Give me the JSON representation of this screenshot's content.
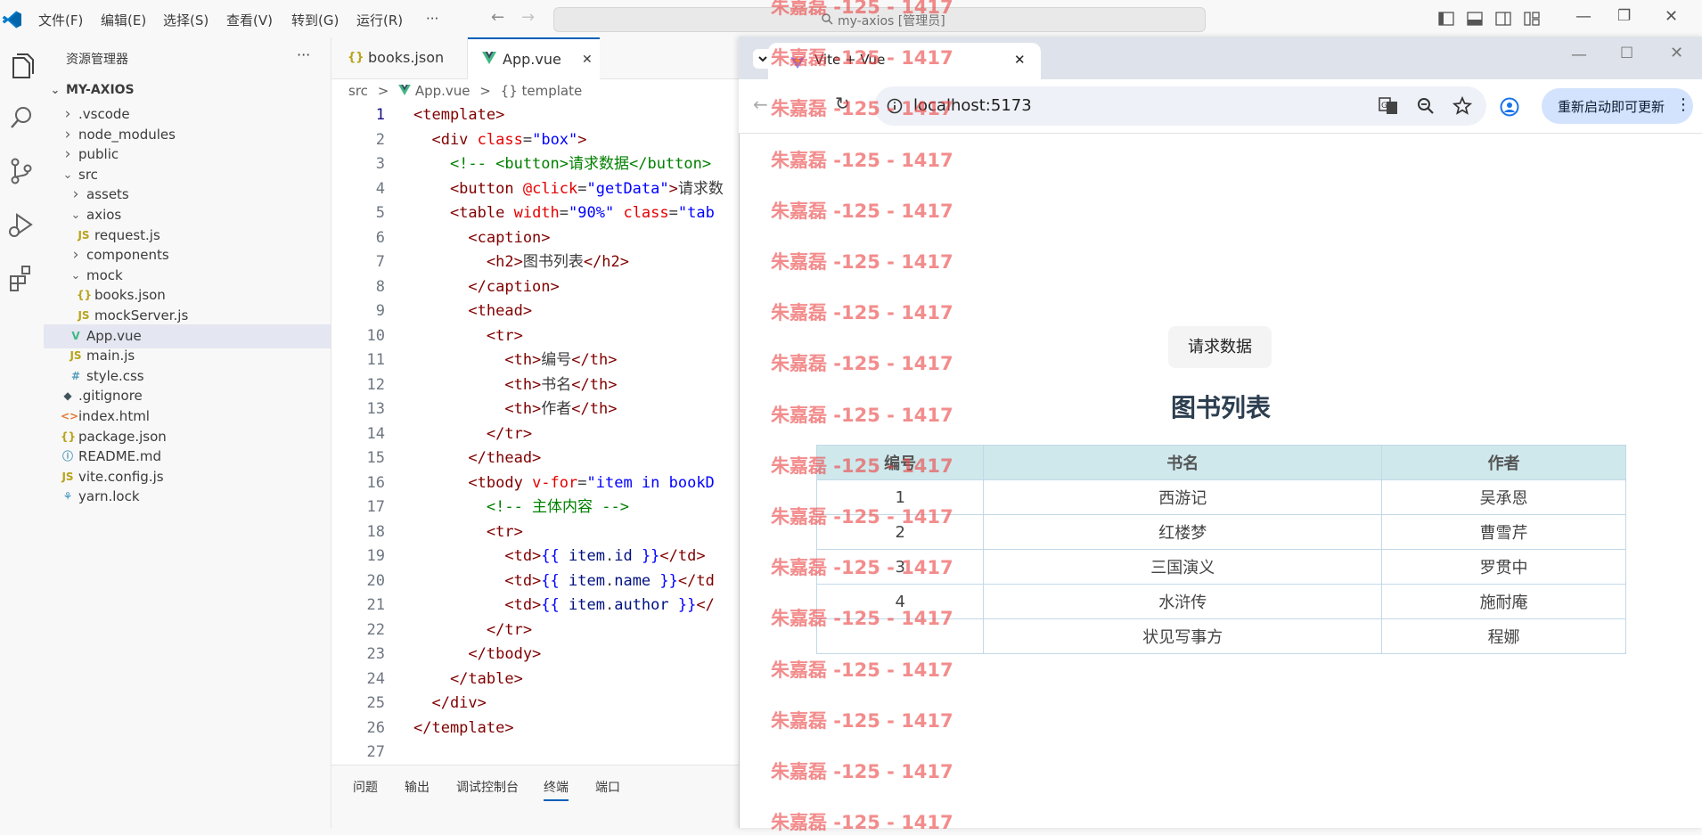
{
  "menu": [
    "文件(F)",
    "编辑(E)",
    "选择(S)",
    "查看(V)",
    "转到(G)",
    "运行(R)",
    "···"
  ],
  "command_center": "my-axios [管理员]",
  "explorer": {
    "title": "资源管理器",
    "more": "···",
    "root": "MY-AXIOS",
    "items": [
      {
        "label": ".vscode",
        "icon": "chevron-right-icon",
        "badge": ""
      },
      {
        "label": "node_modules",
        "icon": "chevron-right-icon",
        "badge": ""
      },
      {
        "label": "public",
        "icon": "chevron-right-icon",
        "badge": ""
      },
      {
        "label": "src",
        "icon": "chevron-down-icon",
        "badge": ""
      },
      {
        "label": "assets",
        "icon": "chevron-right-icon",
        "badge": ""
      },
      {
        "label": "axios",
        "icon": "chevron-down-icon",
        "badge": ""
      },
      {
        "label": "request.js",
        "icon": "js-file-icon",
        "badge": "JS"
      },
      {
        "label": "components",
        "icon": "chevron-right-icon",
        "badge": ""
      },
      {
        "label": "mock",
        "icon": "chevron-down-icon",
        "badge": ""
      },
      {
        "label": "books.json",
        "icon": "json-file-icon",
        "badge": "{}"
      },
      {
        "label": "mockServer.js",
        "icon": "js-file-icon",
        "badge": "JS"
      },
      {
        "label": "App.vue",
        "icon": "vue-file-icon",
        "badge": "V"
      },
      {
        "label": "main.js",
        "icon": "js-file-icon",
        "badge": "JS"
      },
      {
        "label": "style.css",
        "icon": "css-file-icon",
        "badge": "#"
      },
      {
        "label": ".gitignore",
        "icon": "git-file-icon",
        "badge": "◆"
      },
      {
        "label": "index.html",
        "icon": "html-file-icon",
        "badge": "<>"
      },
      {
        "label": "package.json",
        "icon": "json-file-icon",
        "badge": "{}"
      },
      {
        "label": "README.md",
        "icon": "info-file-icon",
        "badge": "ⓘ"
      },
      {
        "label": "vite.config.js",
        "icon": "js-file-icon",
        "badge": "JS"
      },
      {
        "label": "yarn.lock",
        "icon": "yarn-file-icon",
        "badge": "⚘"
      }
    ]
  },
  "editor": {
    "tabs": [
      {
        "label": "books.json",
        "badge": "{}",
        "close": ""
      },
      {
        "label": "App.vue",
        "badge": "V",
        "close": "✕"
      }
    ],
    "breadcrumb": {
      "seg1": "src",
      "seg2": "App.vue",
      "seg3": "{} template",
      "sep": ">"
    },
    "lines": [
      "1",
      "2",
      "3",
      "4",
      "5",
      "6",
      "7",
      "8",
      "9",
      "10",
      "11",
      "12",
      "13",
      "14",
      "15",
      "16",
      "17",
      "18",
      "19",
      "20",
      "21",
      "22",
      "23",
      "24",
      "25",
      "26",
      "27"
    ]
  },
  "panel_tabs": [
    "问题",
    "输出",
    "调试控制台",
    "终端",
    "端口"
  ],
  "browser": {
    "tab_title": "Vite + Vue",
    "tab_close": "✕",
    "new_tab": "+",
    "url": "localhost:5173",
    "restart_label": "重新启动即可更新",
    "restart_menu": "⋮"
  },
  "page": {
    "button": "请求数据",
    "title": "图书列表",
    "headers": [
      "编号",
      "书名",
      "作者"
    ],
    "rows": [
      [
        "1",
        "西游记",
        "吴承恩"
      ],
      [
        "2",
        "红楼梦",
        "曹雪芹"
      ],
      [
        "3",
        "三国演义",
        "罗贯中"
      ],
      [
        "4",
        "水浒传",
        "施耐庵"
      ],
      [
        "",
        "状见写事方",
        "程娜"
      ]
    ]
  },
  "watermark": "朱嘉磊 -125 - 1417",
  "colors": {
    "vue_green": "#41b883",
    "js_yellow": "#b8a31a",
    "accent_blue": "#005fb8"
  }
}
